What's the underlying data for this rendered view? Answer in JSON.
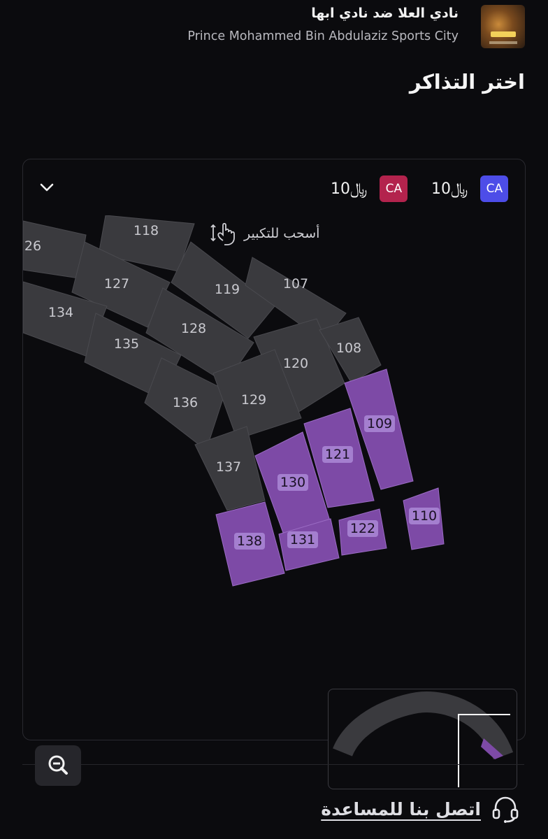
{
  "event": {
    "title": "نادي العلا ضد نادي ابها",
    "venue": "Prince Mohammed Bin Abdulaziz Sports City"
  },
  "page_title": "اختر التذاكر",
  "prices": [
    {
      "badge": "CA",
      "color": "#4d4de8",
      "amount": "10",
      "currency": "⃁"
    },
    {
      "badge": "CA",
      "color": "#b3234d",
      "amount": "10",
      "currency": "⃁"
    }
  ],
  "map": {
    "drag_hint": "أسحب للتكبير",
    "colors": {
      "unavailable": "#3a3a3e",
      "available": "#7d4aa6",
      "background": "#0b0b0e"
    },
    "sections": [
      {
        "label": "26",
        "available": false
      },
      {
        "label": "118",
        "available": false
      },
      {
        "label": "127",
        "available": false
      },
      {
        "label": "134",
        "available": false
      },
      {
        "label": "119",
        "available": false
      },
      {
        "label": "107",
        "available": false
      },
      {
        "label": "128",
        "available": false
      },
      {
        "label": "135",
        "available": false
      },
      {
        "label": "120",
        "available": false
      },
      {
        "label": "108",
        "available": false
      },
      {
        "label": "136",
        "available": false
      },
      {
        "label": "129",
        "available": false
      },
      {
        "label": "137",
        "available": false
      },
      {
        "label": "109",
        "available": true
      },
      {
        "label": "121",
        "available": true
      },
      {
        "label": "130",
        "available": true
      },
      {
        "label": "110",
        "available": true
      },
      {
        "label": "122",
        "available": true
      },
      {
        "label": "131",
        "available": true
      },
      {
        "label": "138",
        "available": true
      }
    ]
  },
  "help": {
    "label": "اتصل بنا للمساعدة",
    "icon": "headset-icon"
  },
  "icons": {
    "collapse": "chevron-down-icon",
    "zoom": "zoom-out-icon",
    "hint": "pinch-hand-icon"
  }
}
